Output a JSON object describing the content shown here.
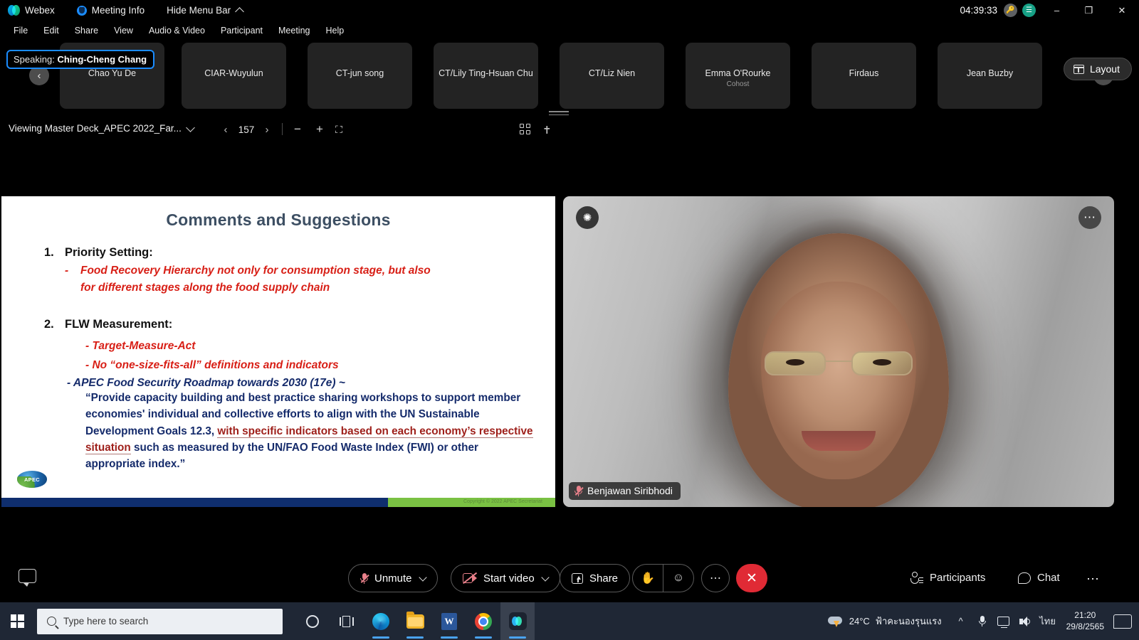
{
  "titlebar": {
    "app_name": "Webex",
    "meeting_info": "Meeting Info",
    "hide_menu_bar": "Hide Menu Bar",
    "elapsed_time": "04:39:33",
    "minimize": "–",
    "maximize": "❐",
    "close": "✕",
    "accent_blue": "#1a8cff",
    "network_badge": "network-quality",
    "key_badge": "key"
  },
  "menubar": {
    "items": [
      "File",
      "Edit",
      "Share",
      "View",
      "Audio & Video",
      "Participant",
      "Meeting",
      "Help"
    ]
  },
  "filmstrip": {
    "speaking_prefix": "Speaking:",
    "speaking_name": "Ching-Cheng Chang",
    "prev_arrow": "‹",
    "next_arrow": "›",
    "layout_label": "Layout",
    "participants": [
      {
        "name": "Chao Yu De",
        "role": ""
      },
      {
        "name": "CIAR-Wuyulun",
        "role": ""
      },
      {
        "name": "CT-jun song",
        "role": ""
      },
      {
        "name": "CT/Lily Ting-Hsuan Chu",
        "role": ""
      },
      {
        "name": "CT/Liz Nien",
        "role": ""
      },
      {
        "name": "Emma O'Rourke",
        "role": "Cohost"
      },
      {
        "name": "Firdaus",
        "role": ""
      },
      {
        "name": "Jean Buzby",
        "role": ""
      }
    ]
  },
  "sharebar": {
    "viewing_title": "Viewing Master Deck_APEC 2022_Far...",
    "page_number": "157",
    "prev_page": "‹",
    "next_page": "›",
    "zoom_out": "−",
    "zoom_in": "+",
    "fit_screen": "⛶",
    "grid_view": "grid-view-icon",
    "annotate": "annotate-icon"
  },
  "slide": {
    "title": "Comments and Suggestions",
    "item1_num": "1.",
    "item1_head": "Priority Setting:",
    "item1_bullet": "-",
    "item1_red_line1": "Food Recovery Hierarchy not only for consumption stage, but also",
    "item1_red_line2": "for different stages along the food supply chain",
    "item2_num": "2.",
    "item2_head": "FLW Measurement:",
    "item2_red_line1": "- Target-Measure-Act",
    "item2_red_line2": "- No “one-size-fits-all” definitions and indicators",
    "item2_navy_line": "- APEC Food Security Roadmap towards 2030 (17e) ~",
    "quote_part1": "“Provide capacity building and best practice sharing workshops to support member economies' individual and collective efforts to align with the UN Sustainable Development Goals 12.3,",
    "quote_highlight": "with specific indicators based on each economy’s respective situation",
    "quote_part2": "such as measured by the UN/FAO Food Waste Index (FWI) or other appropriate index.”",
    "logo_text": "APEC",
    "copyright": "Copyright © 2022 APEC Secretariat",
    "colors": {
      "title": "#3d4f63",
      "red": "#d81f16",
      "navy": "#152b6b",
      "dark_red": "#9e1f1a",
      "footer_blue": "#0f2e6e",
      "footer_green": "#7ac143"
    }
  },
  "video": {
    "participant_name": "Benjawan Siribhodi",
    "mic_state": "muted",
    "unpin_icon": "unpin-icon",
    "more_icon": "⋯"
  },
  "controls": {
    "chat_left_icon": "message-icon",
    "unmute_label": "Unmute",
    "start_video_label": "Start video",
    "share_label": "Share",
    "raise_hand_icon": "✋",
    "reactions_icon": "☺",
    "more_icon": "⋯",
    "end_call_icon": "✕",
    "participants_label": "Participants",
    "chat_label": "Chat",
    "right_more_icon": "⋯",
    "end_call_color": "#e02a35"
  },
  "taskbar": {
    "search_placeholder": "Type here to search",
    "start_icon": "windows-start-icon",
    "apps": [
      "cortana-icon",
      "task-view-icon",
      "edge-icon",
      "file-explorer-icon",
      "word-icon",
      "chrome-icon",
      "webex-icon"
    ],
    "weather_temp": "24°C",
    "weather_desc": "ฟ้าคะนองรุนแรง",
    "show_hidden": "˄",
    "language": "ไทย",
    "clock_time": "21:20",
    "clock_date": "29/8/2565"
  }
}
